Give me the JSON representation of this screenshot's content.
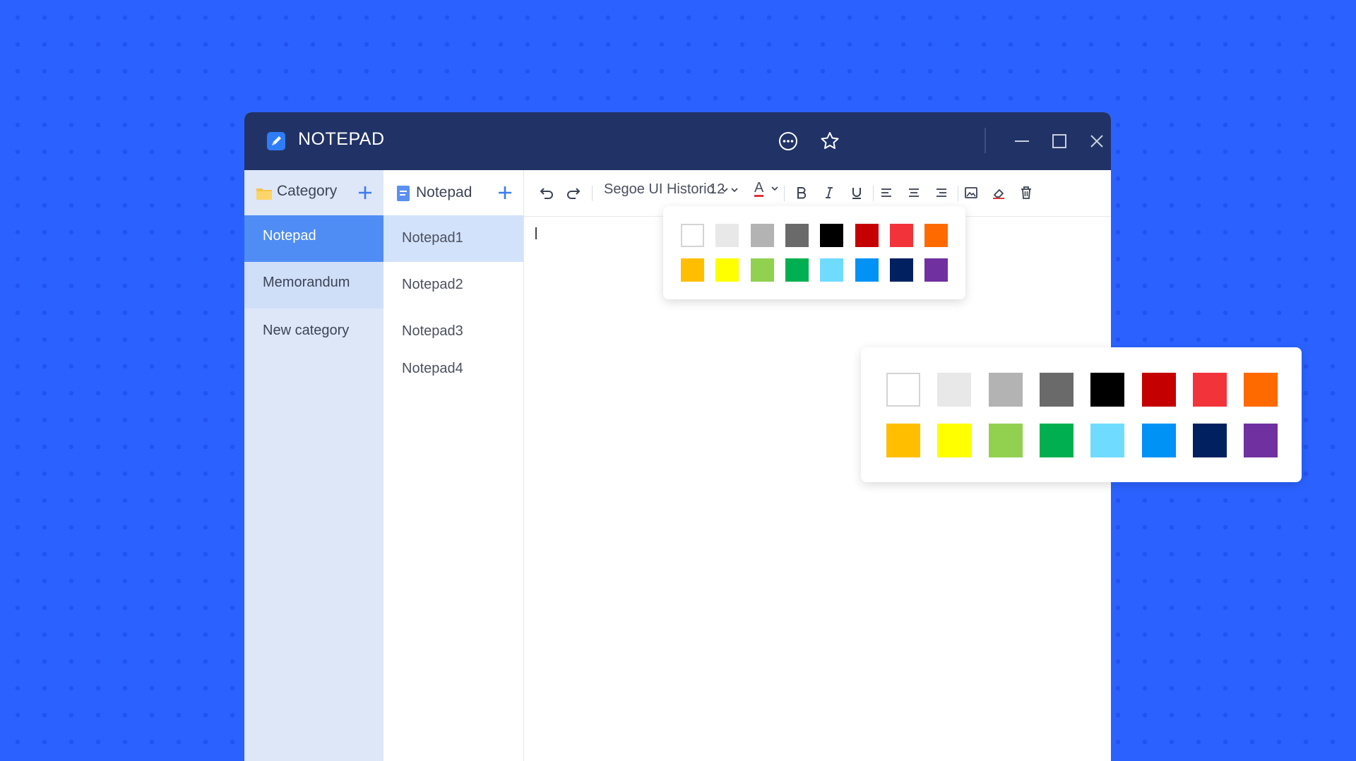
{
  "window": {
    "title": "NOTEPAD"
  },
  "titlebar": {
    "icons": [
      "more-icon",
      "star-icon",
      "minimize-icon",
      "maximize-icon",
      "close-icon"
    ]
  },
  "categories": {
    "header": "Category",
    "items": [
      {
        "label": "Notepad",
        "state": "active"
      },
      {
        "label": "Memorandum",
        "state": "alt"
      },
      {
        "label": "New category",
        "state": "normal"
      }
    ]
  },
  "notes": {
    "header": "Notepad",
    "items": [
      {
        "label": "Notepad1",
        "state": "active"
      },
      {
        "label": "Notepad2",
        "state": "normal"
      },
      {
        "label": "Notepad3",
        "state": "normal"
      },
      {
        "label": "Notepad4",
        "state": "normal"
      }
    ]
  },
  "toolbar": {
    "font_family": "Segoe UI Historic",
    "font_size": "12",
    "font_color_label": "A"
  },
  "palette": {
    "colors": [
      "#ffffff",
      "#e8e8e8",
      "#b3b3b3",
      "#6a6a6a",
      "#000000",
      "#c40000",
      "#f2333a",
      "#ff6a00",
      "#ffbf00",
      "#ffff00",
      "#92d050",
      "#00b050",
      "#6fdcff",
      "#0092f5",
      "#002060",
      "#7030a0"
    ]
  }
}
